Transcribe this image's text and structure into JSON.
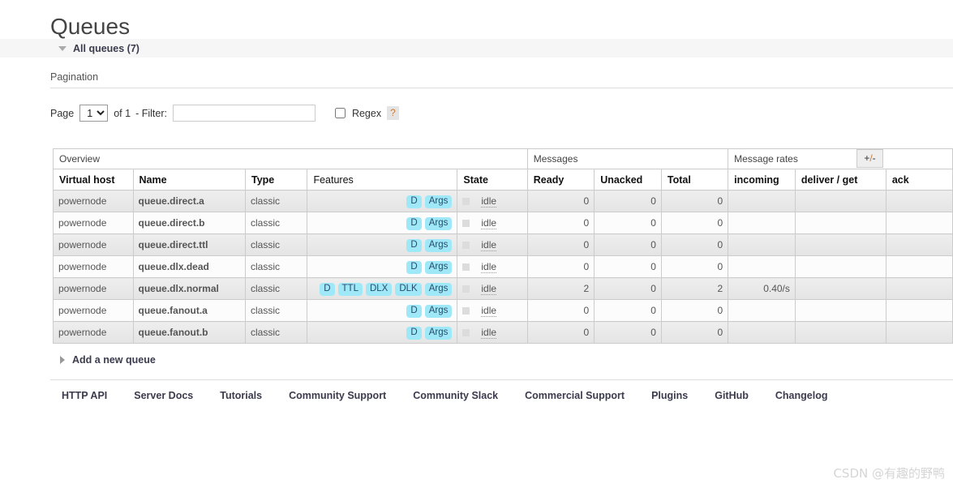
{
  "page": {
    "title": "Queues",
    "collapsible_label": "All queues (7)"
  },
  "pagination": {
    "heading": "Pagination",
    "page_label": "Page",
    "page_value": "1",
    "page_options": [
      "1"
    ],
    "of_label": "of 1",
    "filter_label": "- Filter:",
    "filter_value": "",
    "filter_placeholder": "",
    "regex_label": "Regex",
    "regex_checked": false,
    "help_label": "?"
  },
  "table": {
    "groups": [
      {
        "label": "Overview",
        "span": 5
      },
      {
        "label": "Messages",
        "span": 3
      },
      {
        "label": "Message rates",
        "span": 3
      }
    ],
    "columns": [
      {
        "label": "Virtual host",
        "sortable": true,
        "align": "left"
      },
      {
        "label": "Name",
        "sortable": true,
        "align": "left"
      },
      {
        "label": "Type",
        "sortable": true,
        "align": "left"
      },
      {
        "label": "Features",
        "sortable": false,
        "align": "left"
      },
      {
        "label": "State",
        "sortable": true,
        "align": "left"
      },
      {
        "label": "Ready",
        "sortable": true,
        "align": "left"
      },
      {
        "label": "Unacked",
        "sortable": true,
        "align": "left"
      },
      {
        "label": "Total",
        "sortable": true,
        "align": "left"
      },
      {
        "label": "incoming",
        "sortable": true,
        "align": "left"
      },
      {
        "label": "deliver / get",
        "sortable": true,
        "align": "left"
      },
      {
        "label": "ack",
        "sortable": true,
        "align": "left"
      }
    ],
    "toggle_columns_label": "+/-",
    "rows": [
      {
        "vhost": "powernode",
        "name": "queue.direct.a",
        "type": "classic",
        "features": [
          "D",
          "Args"
        ],
        "state": "idle",
        "ready": "0",
        "unacked": "0",
        "total": "0",
        "incoming": "",
        "deliver_get": "",
        "ack": ""
      },
      {
        "vhost": "powernode",
        "name": "queue.direct.b",
        "type": "classic",
        "features": [
          "D",
          "Args"
        ],
        "state": "idle",
        "ready": "0",
        "unacked": "0",
        "total": "0",
        "incoming": "",
        "deliver_get": "",
        "ack": ""
      },
      {
        "vhost": "powernode",
        "name": "queue.direct.ttl",
        "type": "classic",
        "features": [
          "D",
          "Args"
        ],
        "state": "idle",
        "ready": "0",
        "unacked": "0",
        "total": "0",
        "incoming": "",
        "deliver_get": "",
        "ack": ""
      },
      {
        "vhost": "powernode",
        "name": "queue.dlx.dead",
        "type": "classic",
        "features": [
          "D",
          "Args"
        ],
        "state": "idle",
        "ready": "0",
        "unacked": "0",
        "total": "0",
        "incoming": "",
        "deliver_get": "",
        "ack": ""
      },
      {
        "vhost": "powernode",
        "name": "queue.dlx.normal",
        "type": "classic",
        "features": [
          "D",
          "TTL",
          "DLX",
          "DLK",
          "Args"
        ],
        "state": "idle",
        "ready": "2",
        "unacked": "0",
        "total": "2",
        "incoming": "0.40/s",
        "deliver_get": "",
        "ack": ""
      },
      {
        "vhost": "powernode",
        "name": "queue.fanout.a",
        "type": "classic",
        "features": [
          "D",
          "Args"
        ],
        "state": "idle",
        "ready": "0",
        "unacked": "0",
        "total": "0",
        "incoming": "",
        "deliver_get": "",
        "ack": ""
      },
      {
        "vhost": "powernode",
        "name": "queue.fanout.b",
        "type": "classic",
        "features": [
          "D",
          "Args"
        ],
        "state": "idle",
        "ready": "0",
        "unacked": "0",
        "total": "0",
        "incoming": "",
        "deliver_get": "",
        "ack": ""
      }
    ]
  },
  "add_queue": {
    "label": "Add a new queue"
  },
  "footer": {
    "links": [
      "HTTP API",
      "Server Docs",
      "Tutorials",
      "Community Support",
      "Community Slack",
      "Commercial Support",
      "Plugins",
      "GitHub",
      "Changelog"
    ]
  },
  "watermark": {
    "text": "CSDN @有趣的野鸭"
  },
  "colors": {
    "badge_bg": "#9fe8f7",
    "badge_text": "#2b4a6f",
    "accent_orange": "#cc7832",
    "row_odd_bg": "#e8e8e8",
    "row_even_bg": "#fcfcfc",
    "bar_bg": "#f6f6f6"
  }
}
